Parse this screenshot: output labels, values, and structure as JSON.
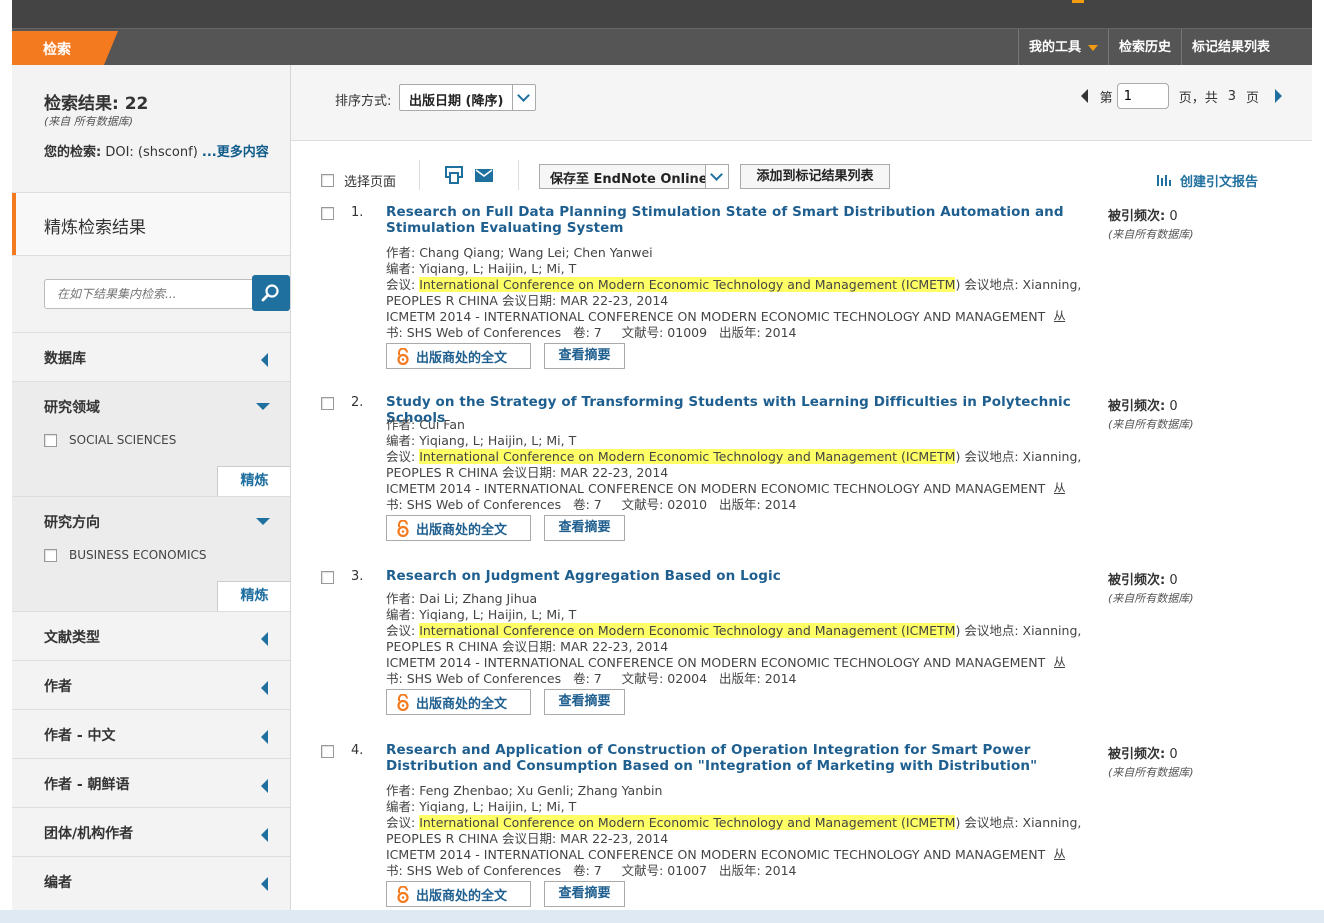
{
  "nav": {
    "search_tab": "检索",
    "my_tools": "我的工具",
    "history": "检索历史",
    "marked_list": "标记结果列表"
  },
  "sidebar": {
    "result_count": "检索结果: 22",
    "result_source": "(来自 所有数据库)",
    "query_label": "您的检索:",
    "query_value": " DOI: (shsconf) ",
    "query_more": "...更多内容",
    "refine_title": "精炼检索结果",
    "search_placeholder": "在如下结果集内检索...",
    "refine_button": "精炼",
    "facets": [
      {
        "label": "数据库"
      },
      {
        "label": "研究领域",
        "option": "SOCIAL SCIENCES"
      },
      {
        "label": "研究方向",
        "option": "BUSINESS ECONOMICS"
      },
      {
        "label": "文献类型"
      },
      {
        "label": "作者"
      },
      {
        "label": "作者 - 中文"
      },
      {
        "label": "作者 - 朝鲜语"
      },
      {
        "label": "团体/机构作者"
      },
      {
        "label": "编者"
      }
    ]
  },
  "sortbar": {
    "label": "排序方式:",
    "value": "出版日期 (降序)",
    "page_prefix": "第",
    "page_value": "1",
    "page_mid": "页，共",
    "page_total": "3",
    "page_suffix": "页"
  },
  "toolbar": {
    "select_page": "选择页面",
    "save_endnote": "保存至 EndNote Online",
    "add_marked": "添加到标记结果列表",
    "cite_report": "创建引文报告"
  },
  "labels": {
    "author": "作者:",
    "editor": "编者:",
    "conference": "会议:",
    "location": "会议地点:",
    "date": "会议日期:",
    "series_tail": "丛",
    "series_head": "书:",
    "volume": "卷:",
    "article_no": "文献号:",
    "year": "出版年:",
    "full_text": "出版商处的全文",
    "view_abstract": "查看摘要",
    "cited_label": "被引频次:",
    "cited_source": "(来自所有数据库)"
  },
  "records": [
    {
      "num": "1.",
      "title": "Research on Full Data Planning Stimulation State of Smart Distribution Automation and Stimulation Evaluating System",
      "authors": "Chang Qiang; Wang Lei; Chen Yanwei",
      "editors": "Yiqiang, L; Haijin, L; Mi, T",
      "conference": "International Conference on Modern Economic Technology and Management (ICMETM",
      "location": "Xianning,",
      "country": "PEOPLES R CHINA",
      "date": "MAR 22-23, 2014",
      "proceedings": "ICMETM 2014 - INTERNATIONAL CONFERENCE ON MODERN ECONOMIC TECHNOLOGY AND MANAGEMENT",
      "series": "SHS Web of Conferences",
      "volume": "7",
      "article_no": "01009",
      "year": "2014",
      "cited": "0"
    },
    {
      "num": "2.",
      "title": "Study on the Strategy of Transforming Students with Learning Difficulties in Polytechnic Schools",
      "authors": "Cui Fan",
      "editors": "Yiqiang, L; Haijin, L; Mi, T",
      "conference": "International Conference on Modern Economic Technology and Management (ICMETM",
      "location": "Xianning,",
      "country": "PEOPLES R CHINA",
      "date": "MAR 22-23, 2014",
      "proceedings": "ICMETM 2014 - INTERNATIONAL CONFERENCE ON MODERN ECONOMIC TECHNOLOGY AND MANAGEMENT",
      "series": "SHS Web of Conferences",
      "volume": "7",
      "article_no": "02010",
      "year": "2014",
      "cited": "0"
    },
    {
      "num": "3.",
      "title": "Research on Judgment Aggregation Based on Logic",
      "authors": "Dai Li; Zhang Jihua",
      "editors": "Yiqiang, L; Haijin, L; Mi, T",
      "conference": "International Conference on Modern Economic Technology and Management (ICMETM",
      "location": "Xianning,",
      "country": "PEOPLES R CHINA",
      "date": "MAR 22-23, 2014",
      "proceedings": "ICMETM 2014 - INTERNATIONAL CONFERENCE ON MODERN ECONOMIC TECHNOLOGY AND MANAGEMENT",
      "series": "SHS Web of Conferences",
      "volume": "7",
      "article_no": "02004",
      "year": "2014",
      "cited": "0"
    },
    {
      "num": "4.",
      "title": "Research and Application of Construction of Operation Integration for Smart Power Distribution and Consumption Based on \"Integration of Marketing with Distribution\"",
      "authors": "Feng Zhenbao; Xu Genli; Zhang Yanbin",
      "editors": "Yiqiang, L; Haijin, L; Mi, T",
      "conference": "International Conference on Modern Economic Technology and Management (ICMETM",
      "location": "Xianning,",
      "country": "PEOPLES R CHINA",
      "date": "MAR 22-23, 2014",
      "proceedings": "ICMETM 2014 - INTERNATIONAL CONFERENCE ON MODERN ECONOMIC TECHNOLOGY AND MANAGEMENT",
      "series": "SHS Web of Conferences",
      "volume": "7",
      "article_no": "01007",
      "year": "2014",
      "cited": "0"
    }
  ],
  "colors": {
    "accent": "#f47a20",
    "link": "#1f5f8f",
    "highlight": "#ffff66",
    "topbar": "#444444",
    "navbar": "#555555"
  }
}
